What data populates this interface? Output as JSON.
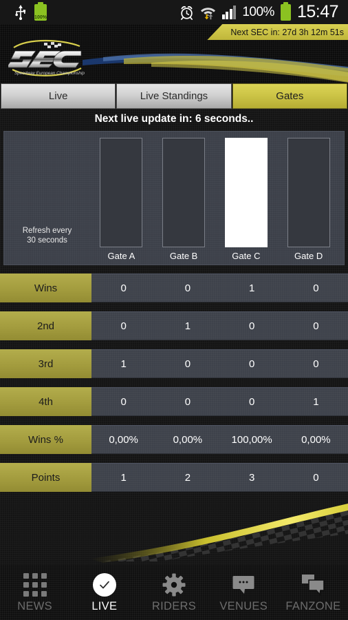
{
  "statusbar": {
    "usb_icon": "usb-icon",
    "battery_icon": "battery-icon",
    "battery_label": "100%",
    "alarm_icon": "alarm-clock-icon",
    "wifi_icon": "wifi-icon",
    "signal_icon": "signal-bars-icon",
    "battery_percent": "100%",
    "clock": "15:47"
  },
  "header": {
    "logo_text": "SEC",
    "logo_tagline": "Speedway European Championship",
    "countdown": "Next SEC in: 27d 3h 12m 51s"
  },
  "tabs": [
    {
      "label": "Live",
      "active": false
    },
    {
      "label": "Live Standings",
      "active": false
    },
    {
      "label": "Gates",
      "active": true
    }
  ],
  "update_status": "Next live update in: 6 seconds..",
  "chart_data": {
    "type": "bar",
    "title": "",
    "categories": [
      "Gate A",
      "Gate B",
      "Gate C",
      "Gate D"
    ],
    "values": [
      0,
      0,
      100,
      0
    ],
    "xlabel": "",
    "ylabel": "",
    "ylim": [
      0,
      100
    ],
    "note": "Refresh every\n30 seconds",
    "note_line1": "Refresh every",
    "note_line2": "30 seconds",
    "filled_color": "#ffffff",
    "empty_color": "#35383f",
    "grid": false,
    "legend": "none"
  },
  "table": {
    "columns": [
      "Gate A",
      "Gate B",
      "Gate C",
      "Gate D"
    ],
    "rows": [
      {
        "label": "Wins",
        "cells": [
          "0",
          "0",
          "1",
          "0"
        ]
      },
      {
        "label": "2nd",
        "cells": [
          "0",
          "1",
          "0",
          "0"
        ]
      },
      {
        "label": "3rd",
        "cells": [
          "1",
          "0",
          "0",
          "0"
        ]
      },
      {
        "label": "4th",
        "cells": [
          "0",
          "0",
          "0",
          "1"
        ]
      },
      {
        "label": "Wins %",
        "cells": [
          "0,00%",
          "0,00%",
          "100,00%",
          "0,00%"
        ]
      },
      {
        "label": "Points",
        "cells": [
          "1",
          "2",
          "3",
          "0"
        ]
      }
    ]
  },
  "bottom_nav": [
    {
      "label": "NEWS",
      "icon": "grid-icon",
      "active": false
    },
    {
      "label": "LIVE",
      "icon": "check-circle-icon",
      "active": true
    },
    {
      "label": "RIDERS",
      "icon": "gear-icon",
      "active": false
    },
    {
      "label": "VENUES",
      "icon": "speech-bubble-icon",
      "active": false
    },
    {
      "label": "FANZONE",
      "icon": "double-speech-bubble-icon",
      "active": false
    }
  ],
  "colors": {
    "accent_yellow": "#cdc547",
    "row_label": "#a39c3e",
    "panel": "#3e424b",
    "active_nav": "#ffffff"
  }
}
